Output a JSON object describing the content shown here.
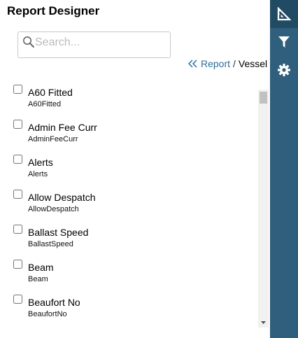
{
  "header": {
    "title": "Report Designer"
  },
  "search": {
    "placeholder": "Search...",
    "value": ""
  },
  "breadcrumb": {
    "items": [
      {
        "label": "Report",
        "link": true
      },
      {
        "label": "Vessel",
        "link": false
      }
    ],
    "separator": "/"
  },
  "fields": [
    {
      "label": "A60 Fitted",
      "key": "A60Fitted",
      "checked": false
    },
    {
      "label": "Admin Fee Curr",
      "key": "AdminFeeCurr",
      "checked": false
    },
    {
      "label": "Alerts",
      "key": "Alerts",
      "checked": false
    },
    {
      "label": "Allow Despatch",
      "key": "AllowDespatch",
      "checked": false
    },
    {
      "label": "Ballast Speed",
      "key": "BallastSpeed",
      "checked": false
    },
    {
      "label": "Beam",
      "key": "Beam",
      "checked": false
    },
    {
      "label": "Beaufort No",
      "key": "BeaufortNo",
      "checked": false
    }
  ],
  "side_rail": {
    "buttons": [
      {
        "name": "layout-button",
        "icon": "ruler-triangle-icon",
        "active": true
      },
      {
        "name": "filter-button",
        "icon": "filter-icon",
        "active": false
      },
      {
        "name": "settings-button",
        "icon": "gear-icon",
        "active": false
      }
    ]
  },
  "colors": {
    "rail": "#2f5f7c",
    "rail_active": "#214a63",
    "link": "#2e6f97"
  }
}
